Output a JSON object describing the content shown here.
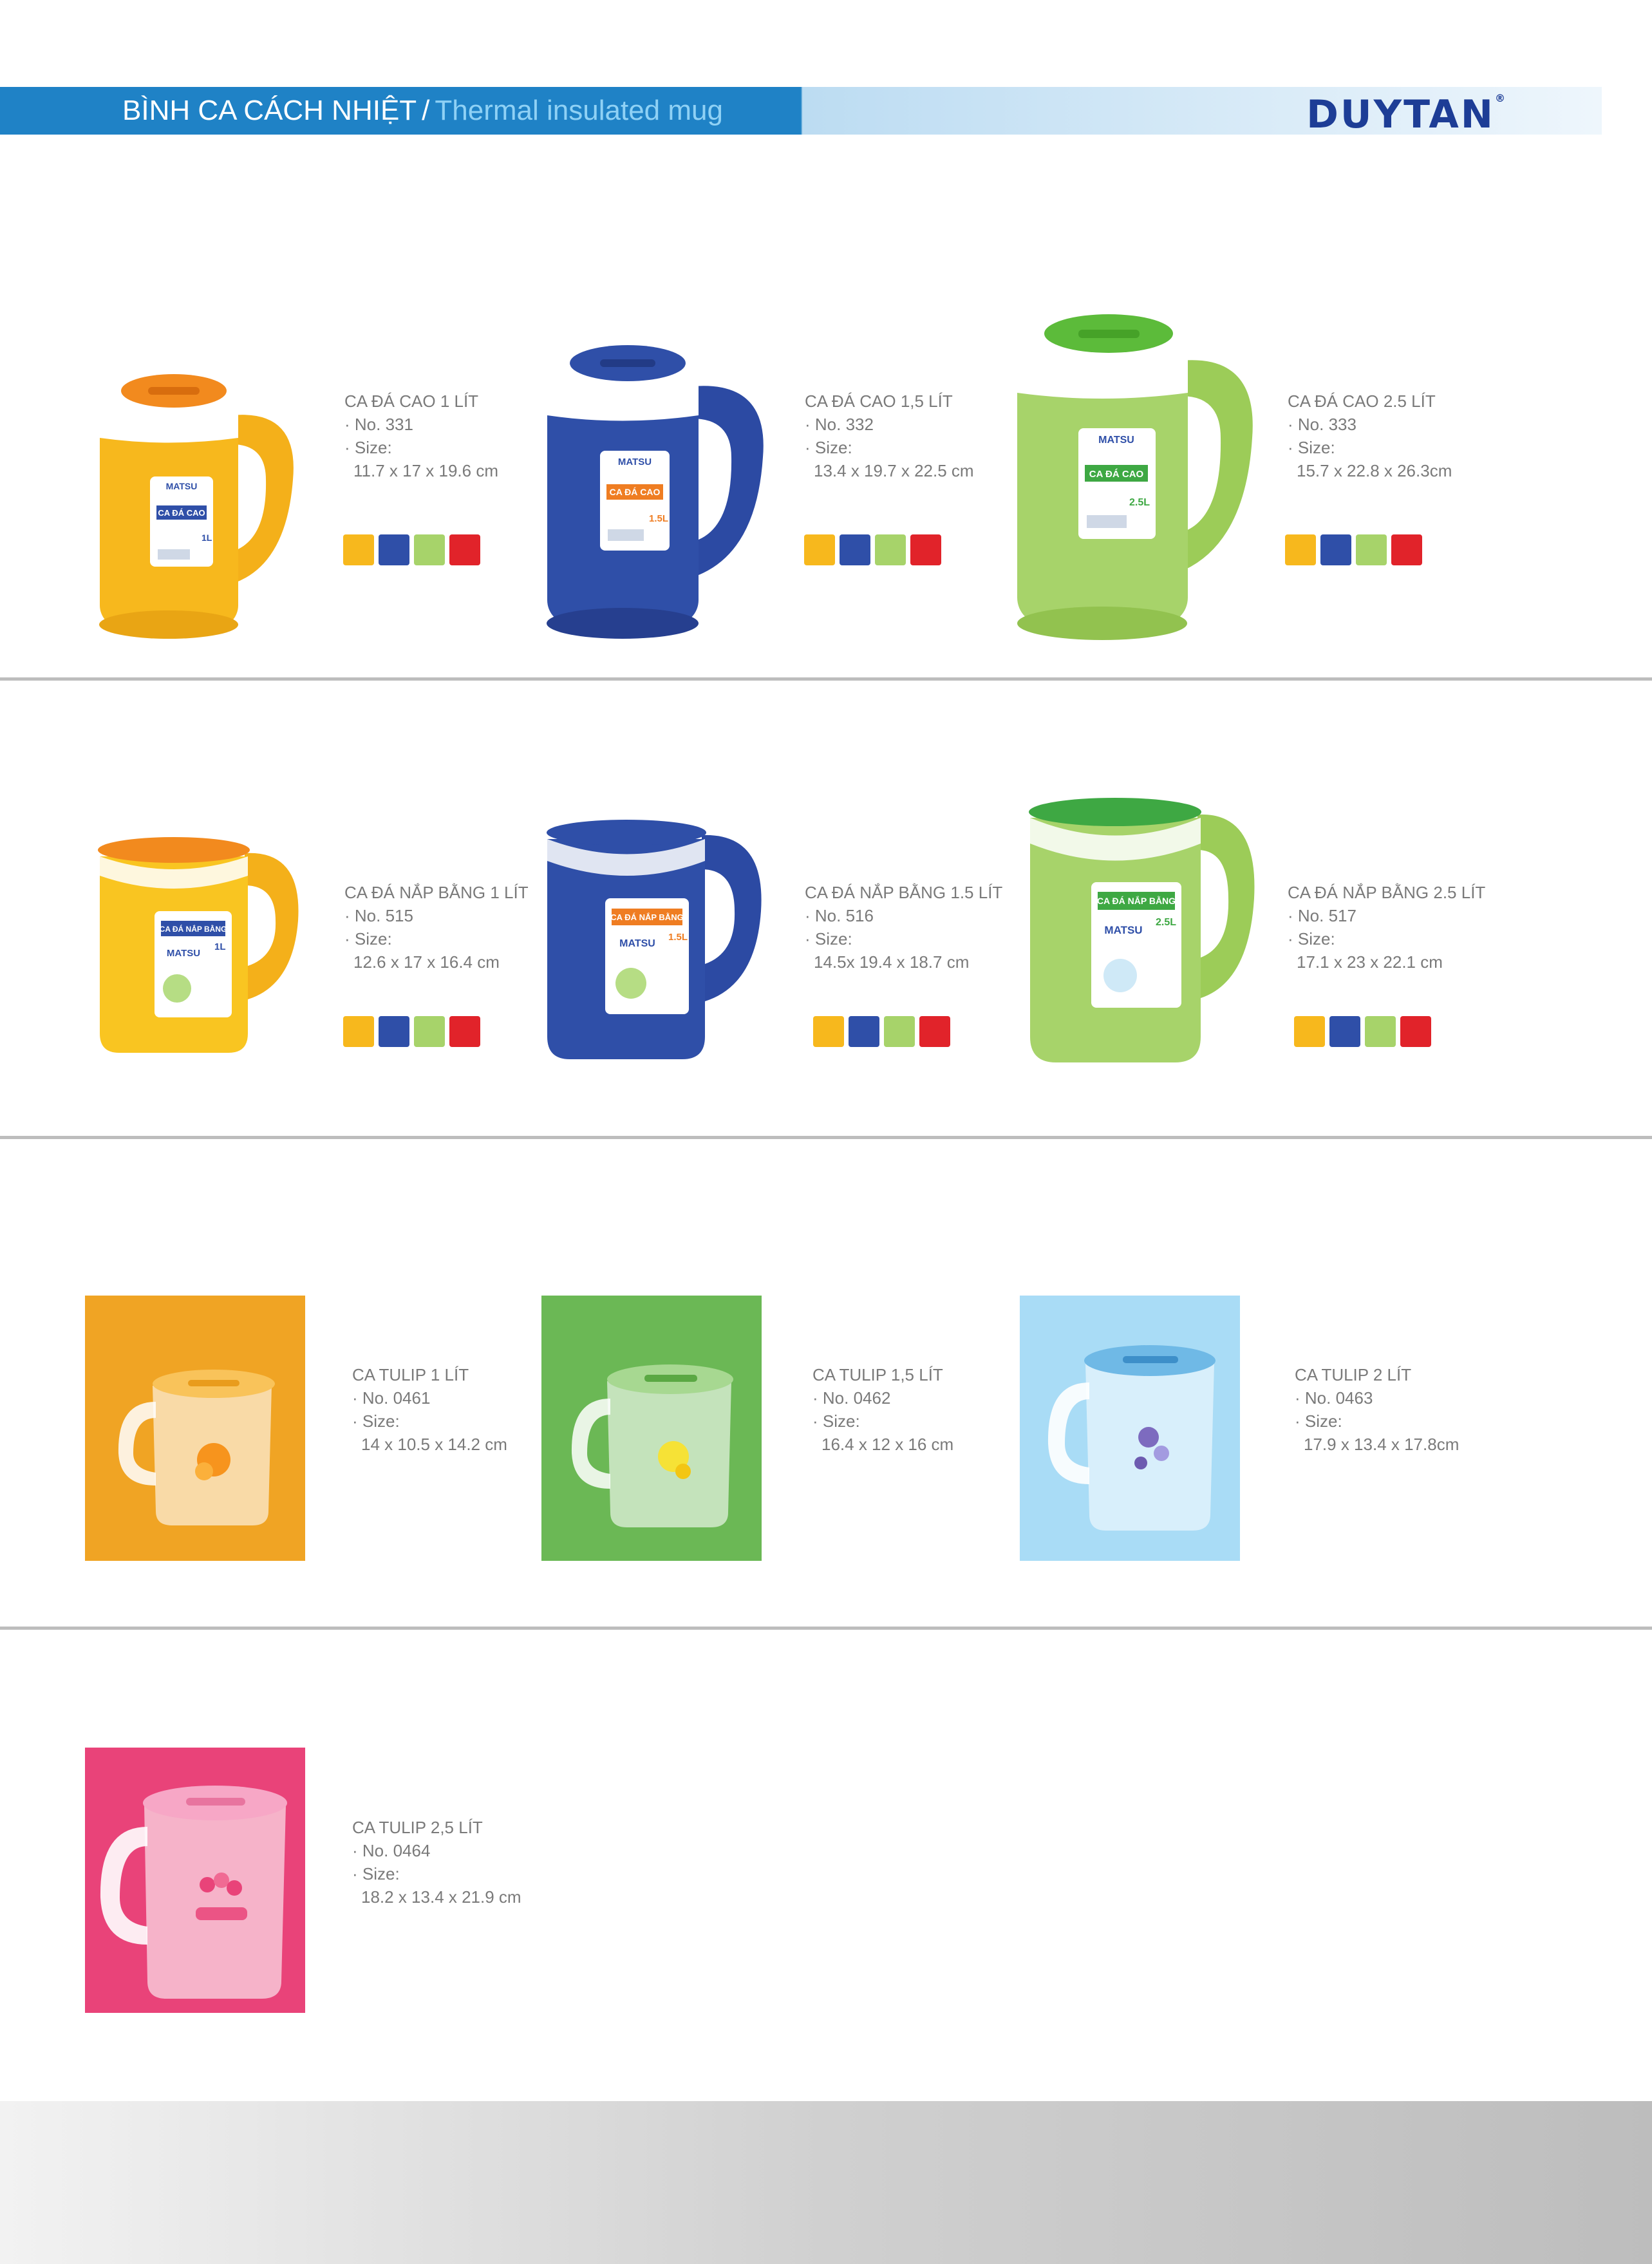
{
  "header": {
    "title_vi": "BÌNH CA CÁCH NHIỆT",
    "separator": "/",
    "title_en": "Thermal insulated mug",
    "brand": "DUYTAN",
    "brand_mark": "®"
  },
  "colors": {
    "yellow": "#f7b81d",
    "blue": "#2f4fa8",
    "green": "#a7d36a",
    "red": "#e1232a",
    "tulip_orange": "#f0a424",
    "tulip_green": "#6bb855",
    "tulip_blue": "#a9dcf6",
    "tulip_pink": "#e94379"
  },
  "rows": [
    {
      "products": [
        {
          "name": "CA ĐÁ CAO 1 LÍT",
          "no": "· No. 331",
          "size_label": "· Size:",
          "size": "11.7 x 17 x 19.6 cm",
          "label_text": "CA ĐÁ CAO",
          "volume": "1L",
          "brand": "MATSU"
        },
        {
          "name": "CA ĐÁ CAO 1,5 LÍT",
          "no": "· No. 332",
          "size_label": "· Size:",
          "size": "13.4 x 19.7 x 22.5 cm",
          "label_text": "CA ĐÁ CAO",
          "volume": "1.5L",
          "brand": "MATSU"
        },
        {
          "name": "CA ĐÁ CAO 2.5 LÍT",
          "no": "· No. 333",
          "size_label": "· Size:",
          "size": "15.7 x 22.8 x 26.3cm",
          "label_text": "CA ĐÁ CAO",
          "volume": "2.5L",
          "brand": "MATSU"
        }
      ]
    },
    {
      "products": [
        {
          "name": "CA ĐÁ NẮP BẰNG 1 LÍT",
          "no": "· No. 515",
          "size_label": "· Size:",
          "size": "12.6 x 17 x 16.4 cm",
          "label_text": "CA ĐÁ NẮP BẰNG",
          "volume": "1L",
          "brand": "MATSU"
        },
        {
          "name": "CA ĐÁ NẮP BẰNG 1.5 LÍT",
          "no": "· No. 516",
          "size_label": "· Size:",
          "size": "14.5x 19.4 x 18.7 cm",
          "label_text": "CA ĐÁ NẮP BẰNG",
          "volume": "1.5L",
          "brand": "MATSU"
        },
        {
          "name": "CA ĐÁ NẮP BẰNG 2.5 LÍT",
          "no": "· No. 517",
          "size_label": "· Size:",
          "size": "17.1 x 23 x 22.1 cm",
          "label_text": "CA ĐÁ NẮP BẰNG",
          "volume": "2.5L",
          "brand": "MATSU"
        }
      ]
    },
    {
      "products": [
        {
          "name": "CA TULIP 1 LÍT",
          "no": "· No. 0461",
          "size_label": "· Size:",
          "size": "14 x 10.5 x 14.2 cm"
        },
        {
          "name": "CA TULIP 1,5 LÍT",
          "no": "· No. 0462",
          "size_label": "· Size:",
          "size": "16.4 x 12 x 16 cm"
        },
        {
          "name": "CA TULIP 2 LÍT",
          "no": "· No. 0463",
          "size_label": "· Size:",
          "size": "17.9 x 13.4 x 17.8cm"
        }
      ]
    },
    {
      "products": [
        {
          "name": "CA TULIP 2,5 LÍT",
          "no": "· No. 0464",
          "size_label": "· Size:",
          "size": "18.2 x 13.4 x 21.9  cm"
        }
      ]
    }
  ]
}
